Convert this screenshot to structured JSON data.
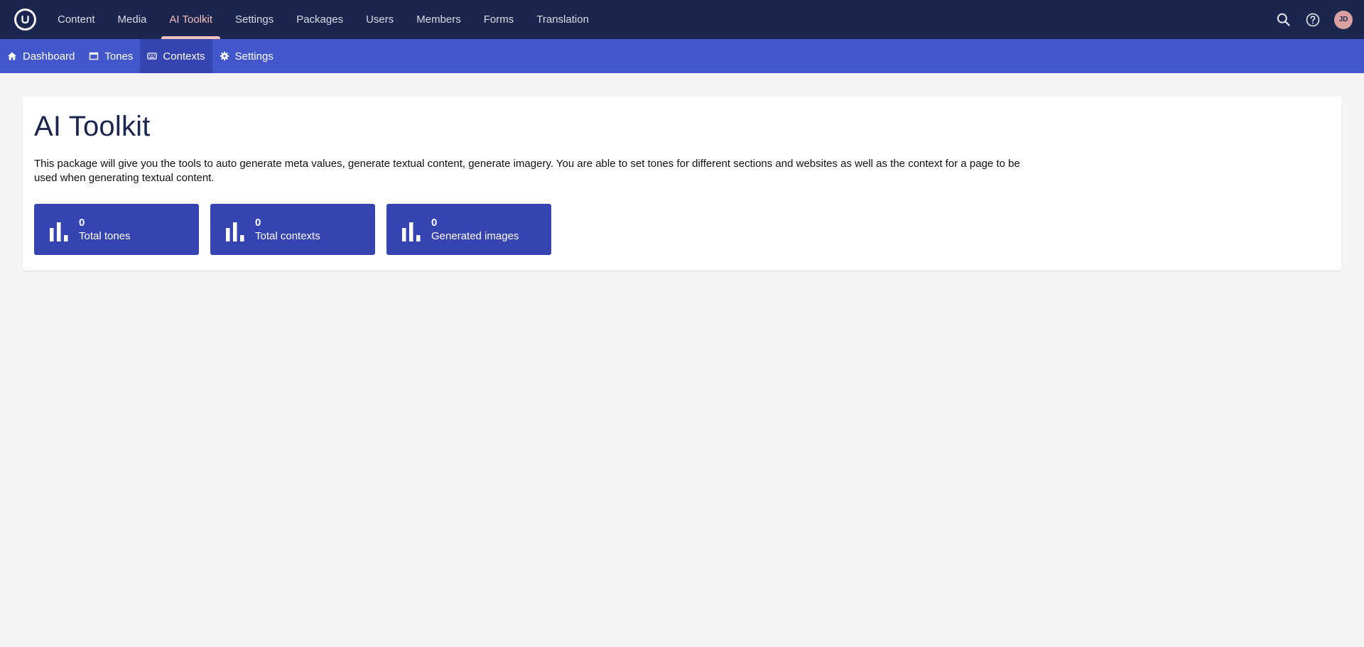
{
  "header": {
    "sections": [
      {
        "label": "Content",
        "active": false
      },
      {
        "label": "Media",
        "active": false
      },
      {
        "label": "AI Toolkit",
        "active": true
      },
      {
        "label": "Settings",
        "active": false
      },
      {
        "label": "Packages",
        "active": false
      },
      {
        "label": "Users",
        "active": false
      },
      {
        "label": "Members",
        "active": false
      },
      {
        "label": "Forms",
        "active": false
      },
      {
        "label": "Translation",
        "active": false
      }
    ],
    "tools": {
      "search_icon": "search-icon",
      "help_icon": "help-icon",
      "avatar_initials": "JD"
    }
  },
  "subnav": {
    "items": [
      {
        "label": "Dashboard",
        "icon": "home-icon"
      },
      {
        "label": "Tones",
        "icon": "window-icon"
      },
      {
        "label": "Contexts",
        "icon": "keyboard-icon",
        "active": true
      },
      {
        "label": "Settings",
        "icon": "gear-icon"
      }
    ]
  },
  "main": {
    "title": "AI Toolkit",
    "description": "This package will give you the tools to auto generate meta values, generate textual content, generate imagery. You are able to set tones for different sections and websites as well as the context for a page to be used when generating textual content.",
    "stats": [
      {
        "value": "0",
        "label": "Total tones",
        "icon": "bar-chart-icon"
      },
      {
        "value": "0",
        "label": "Total contexts",
        "icon": "bar-chart-icon"
      },
      {
        "value": "0",
        "label": "Generated images",
        "icon": "bar-chart-icon"
      }
    ]
  },
  "colors": {
    "header_bg": "#1b264f",
    "subnav_bg": "#4257cb",
    "subnav_active_bg": "#3544b1",
    "accent": "#f5c1bc",
    "stat_bg": "#3544b1",
    "page_bg": "#f5f4f4"
  }
}
